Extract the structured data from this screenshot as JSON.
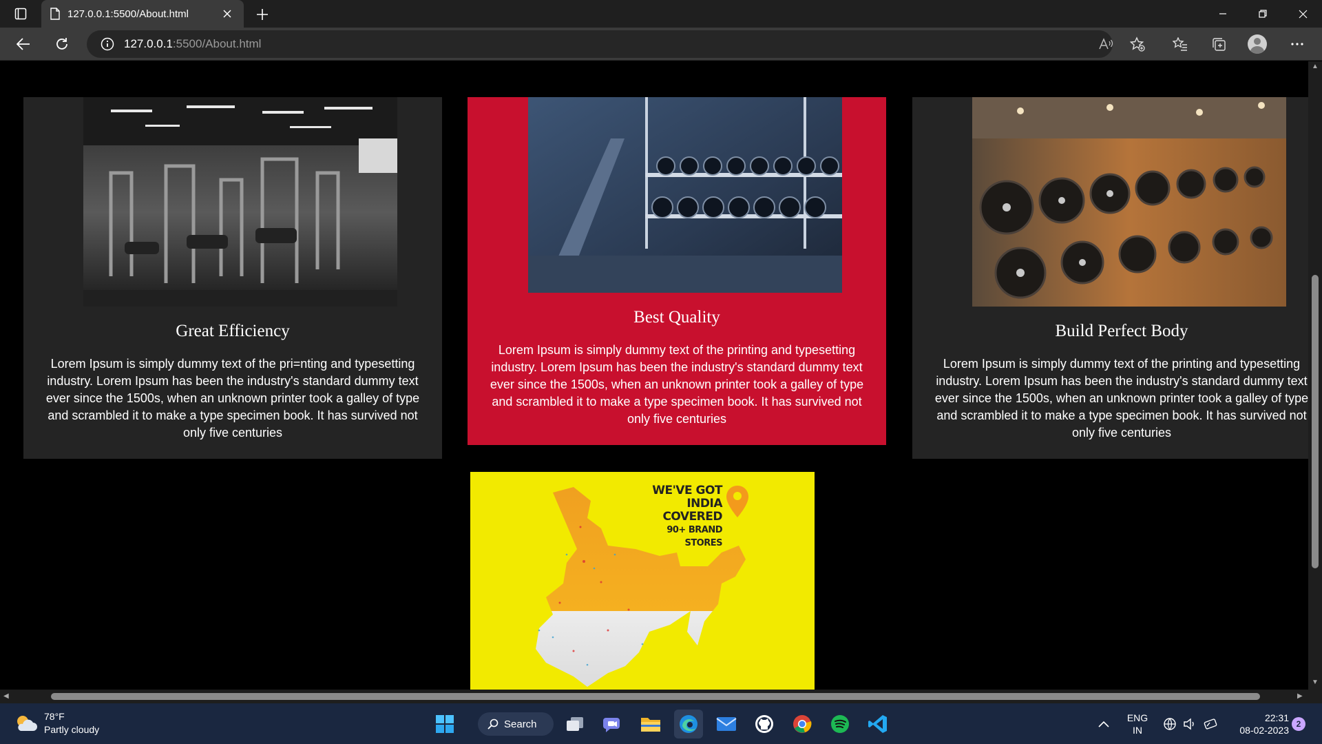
{
  "browser": {
    "tab_title": "127.0.0.1:5500/About.html",
    "url_host": "127.0.0.1",
    "url_rest": ":5500/About.html"
  },
  "cards": [
    {
      "title": "Great Efficiency",
      "text": "Lorem Ipsum is simply dummy text of the pri=nting and typesetting industry. Lorem Ipsum has been the industry's standard dummy text ever since the 1500s, when an unknown printer took a galley of type and scrambled it to make a type specimen book. It has survived not only five centuries"
    },
    {
      "title": "Best Quality",
      "text": "Lorem Ipsum is simply dummy text of the printing and typesetting industry. Lorem Ipsum has been the industry's standard dummy text ever since the 1500s, when an unknown printer took a galley of type and scrambled it to make a type specimen book. It has survived not only five centuries"
    },
    {
      "title": "Build Perfect Body",
      "text": "Lorem Ipsum is simply dummy text of the printing and typesetting industry. Lorem Ipsum has been the industry's standard dummy text ever since the 1500s, when an unknown printer took a galley of type and scrambled it to make a type specimen book. It has survived not only five centuries"
    }
  ],
  "map_banner": {
    "line1": "WE'VE GOT",
    "line2": "INDIA COVERED",
    "line3": "90+ BRAND STORES"
  },
  "taskbar": {
    "temperature": "78°F",
    "weather": "Partly cloudy",
    "search_label": "Search",
    "lang1": "ENG",
    "lang2": "IN",
    "time": "22:31",
    "date": "08-02-2023",
    "notification_count": "2"
  },
  "colors": {
    "card_dark": "#242424",
    "card_red": "#c8102e",
    "map_yellow": "#f2ea00",
    "taskbar": "#1a2740"
  }
}
